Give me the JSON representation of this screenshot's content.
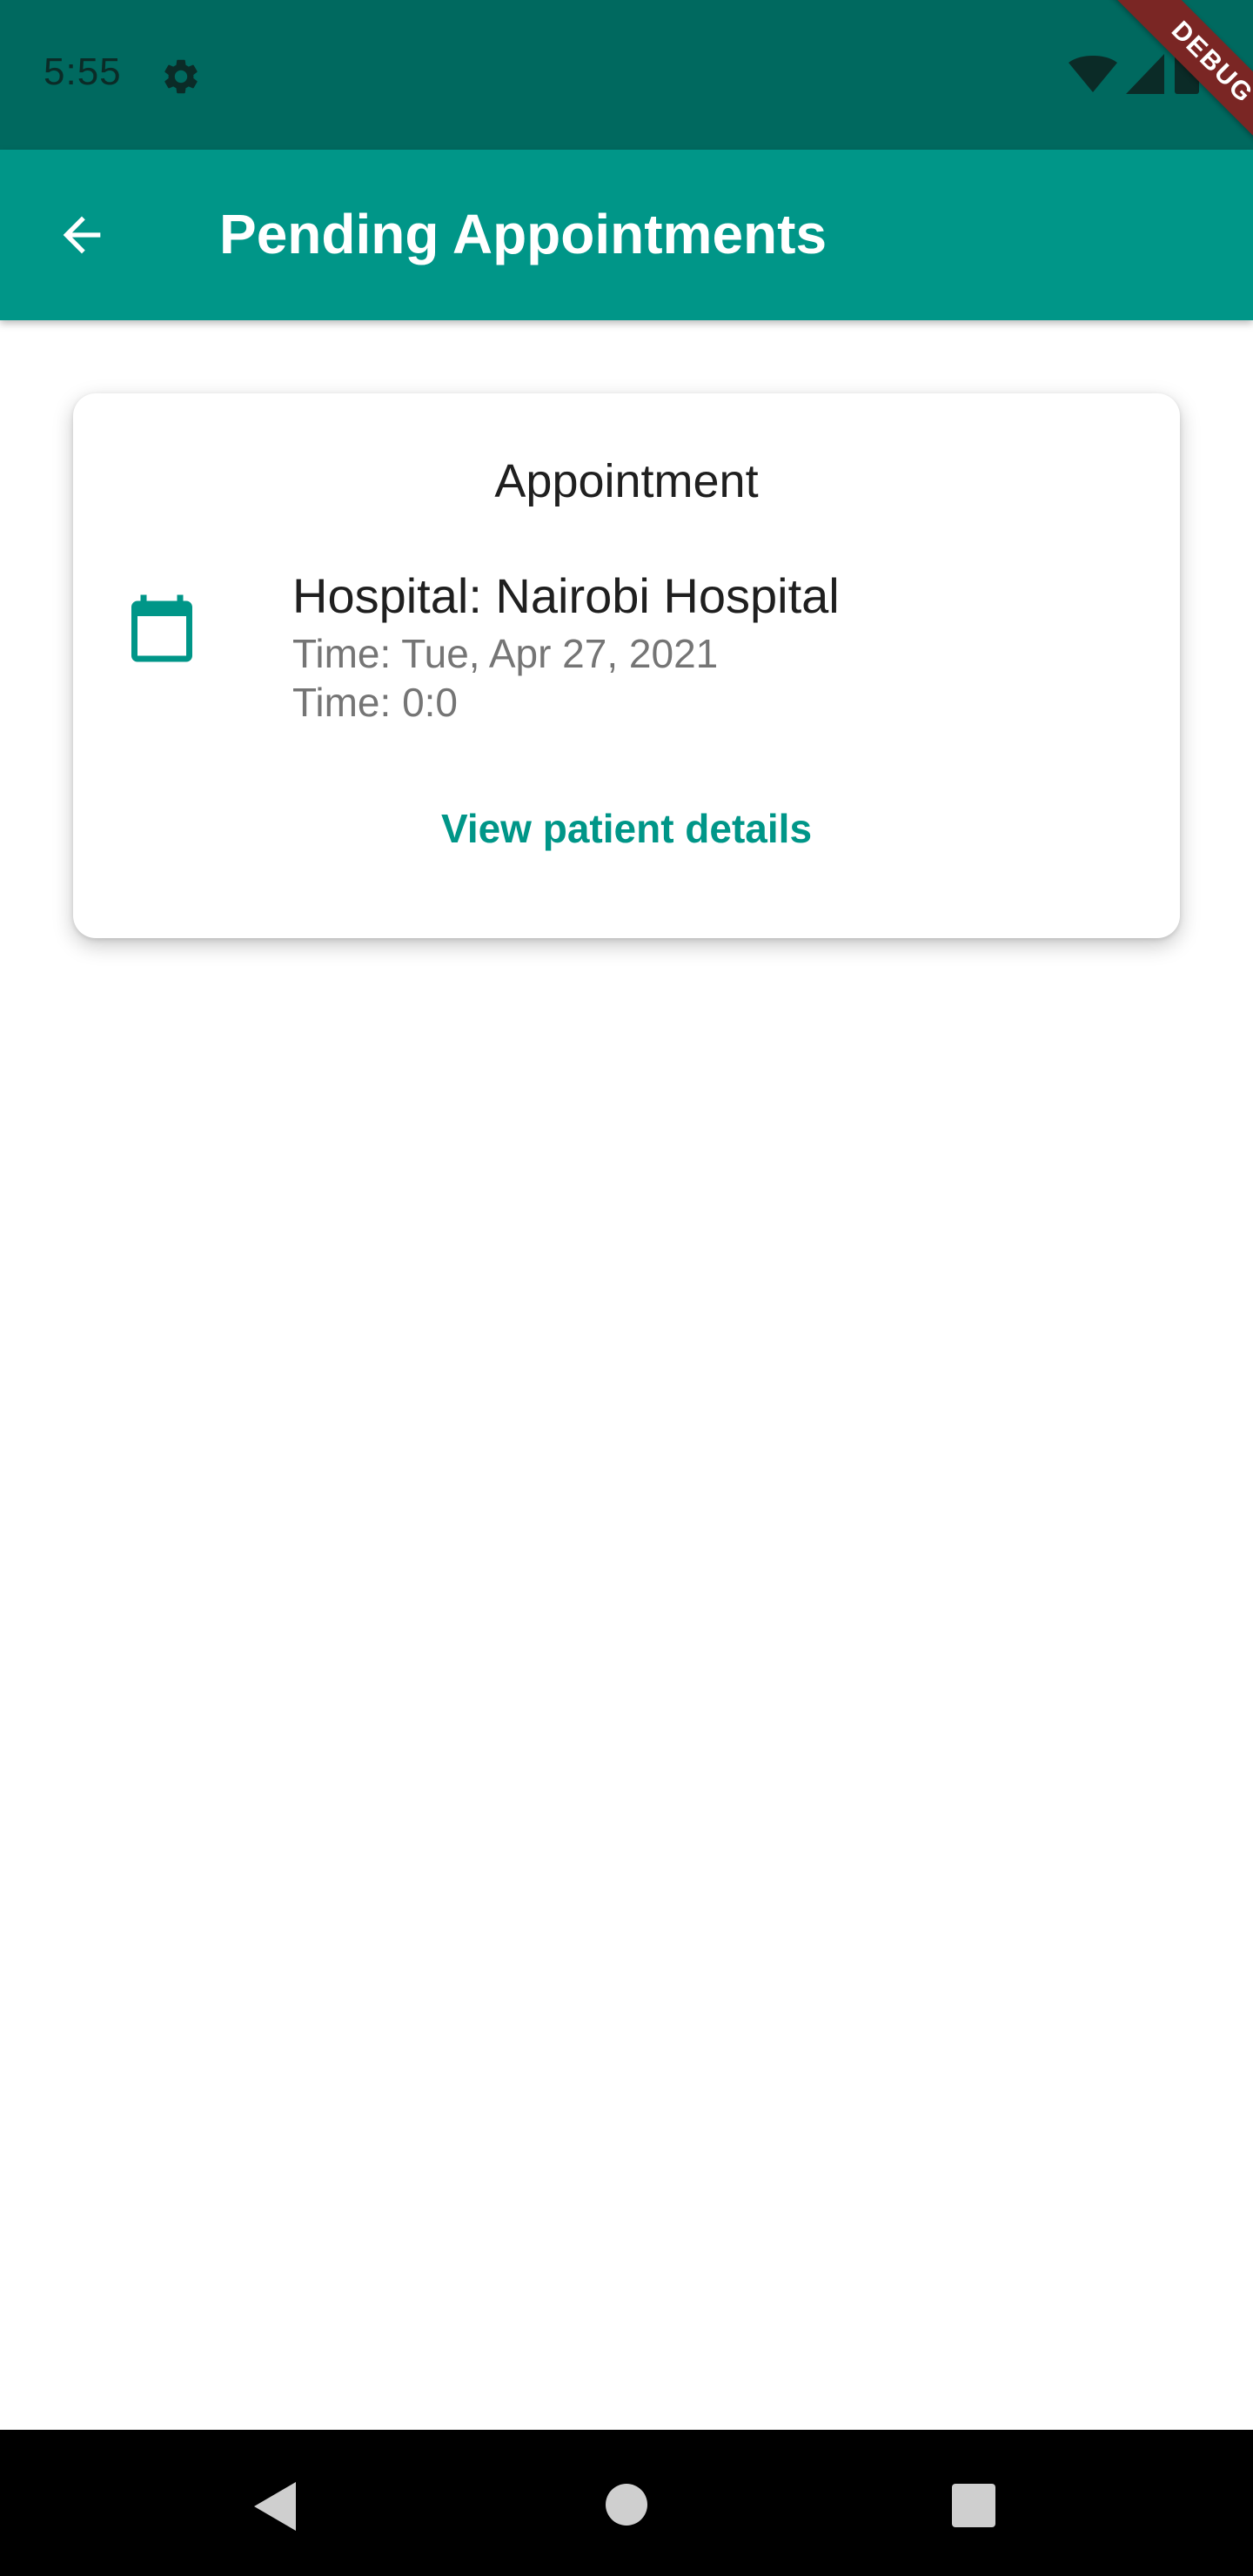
{
  "status_bar": {
    "time": "5:55",
    "icons": [
      "gear-icon",
      "wifi-icon",
      "signal-icon",
      "battery-icon"
    ]
  },
  "debug_banner": {
    "label": "DEBUG"
  },
  "app_bar": {
    "title": "Pending Appointments",
    "back_icon": "arrow-back-icon"
  },
  "appointment_card": {
    "title": "Appointment",
    "icon": "calendar-icon",
    "hospital": "Hospital: Nairobi Hospital",
    "date": "Time: Tue, Apr 27, 2021",
    "time": "Time: 0:0",
    "action_label": "View patient details"
  },
  "nav_bar": {
    "icons": [
      "nav-back-icon",
      "nav-home-icon",
      "nav-recents-icon"
    ]
  },
  "colors": {
    "primary": "#009688",
    "primary_dark": "#00695f",
    "debug_banner": "#7a2624",
    "text_primary": "#1f1f1f",
    "text_secondary": "#757575"
  }
}
